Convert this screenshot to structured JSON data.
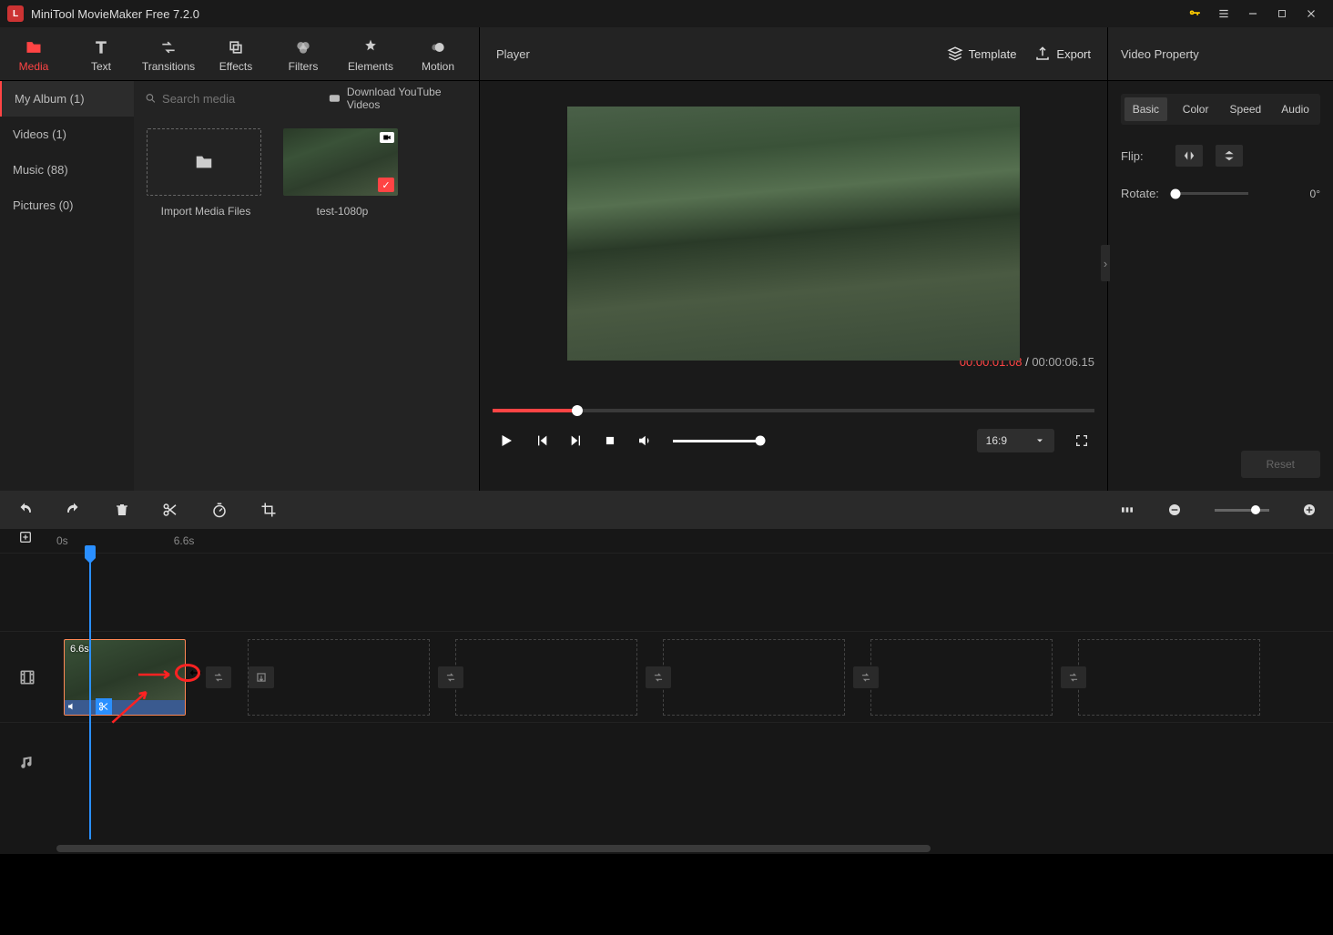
{
  "titlebar": {
    "title": "MiniTool MovieMaker Free 7.2.0"
  },
  "mainTabs": {
    "media": "Media",
    "text": "Text",
    "transitions": "Transitions",
    "effects": "Effects",
    "filters": "Filters",
    "elements": "Elements",
    "motion": "Motion"
  },
  "sidebar": {
    "items": [
      {
        "label": "My Album (1)"
      },
      {
        "label": "Videos (1)"
      },
      {
        "label": "Music (88)"
      },
      {
        "label": "Pictures (0)"
      }
    ]
  },
  "search": {
    "placeholder": "Search media",
    "downloadLabel": "Download YouTube Videos"
  },
  "mediaItems": {
    "import": "Import Media Files",
    "clip1": "test-1080p"
  },
  "player": {
    "title": "Player",
    "template": "Template",
    "export": "Export",
    "currentTime": "00:00:01.08",
    "sep": " / ",
    "duration": "00:00:06.15",
    "aspect": "16:9"
  },
  "property": {
    "title": "Video Property",
    "tabs": {
      "basic": "Basic",
      "color": "Color",
      "speed": "Speed",
      "audio": "Audio"
    },
    "flipLabel": "Flip:",
    "rotateLabel": "Rotate:",
    "rotateValue": "0°",
    "reset": "Reset"
  },
  "ruler": {
    "t0": "0s",
    "t1": "6.6s"
  },
  "clip": {
    "duration": "6.6s"
  }
}
